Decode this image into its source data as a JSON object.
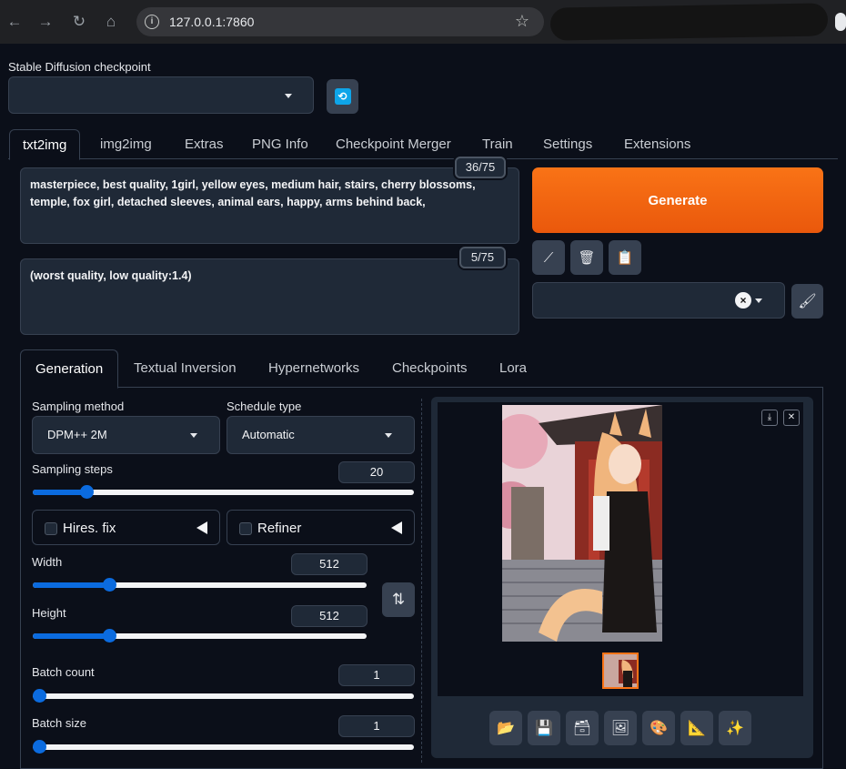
{
  "browser": {
    "url": "127.0.0.1:7860"
  },
  "checkpoint": {
    "label": "Stable Diffusion checkpoint",
    "value": ""
  },
  "main_tabs": [
    "txt2img",
    "img2img",
    "Extras",
    "PNG Info",
    "Checkpoint Merger",
    "Train",
    "Settings",
    "Extensions"
  ],
  "prompt": {
    "positive": "masterpiece, best quality, 1girl, yellow eyes, medium hair, stairs, cherry blossoms, temple, fox girl, detached sleeves, animal ears, happy, arms behind back,",
    "positive_count": "36/75",
    "negative": "(worst quality, low quality:1.4)",
    "negative_count": "5/75"
  },
  "generate_label": "Generate",
  "sub_tabs": [
    "Generation",
    "Textual Inversion",
    "Hypernetworks",
    "Checkpoints",
    "Lora"
  ],
  "settings": {
    "sampling_method_label": "Sampling method",
    "sampling_method": "DPM++ 2M",
    "schedule_type_label": "Schedule type",
    "schedule_type": "Automatic",
    "sampling_steps_label": "Sampling steps",
    "sampling_steps": "20",
    "hires_label": "Hires. fix",
    "refiner_label": "Refiner",
    "width_label": "Width",
    "width": "512",
    "height_label": "Height",
    "height": "512",
    "batch_count_label": "Batch count",
    "batch_count": "1",
    "batch_size_label": "Batch size",
    "batch_size": "1"
  },
  "slider_fractions": {
    "steps": 0.14,
    "width": 0.23,
    "height": 0.23,
    "batch_count": 0.0,
    "batch_size": 0.0
  },
  "colors": {
    "accent": "#f97316",
    "slider": "#0b6bdf",
    "background": "#0b0f19",
    "panel": "#1f2937"
  }
}
